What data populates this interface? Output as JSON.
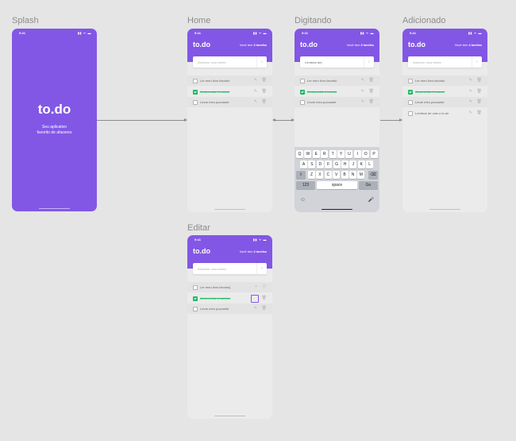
{
  "frames": {
    "splash": "Splash",
    "home": "Home",
    "typing": "Digitando",
    "added": "Adicionado",
    "edit": "Editar"
  },
  "status_time": "9:41",
  "status_icons": "▮▮ ᯤ ▬",
  "app": {
    "logo": "to.do",
    "tagline_1": "Seu aplicativo",
    "tagline_2": "favorito de afazeres",
    "count_prefix": "Você tem",
    "count_3": "3 tarefas",
    "count_4": "4 tarefas",
    "input_placeholder": "Adicione uma tarefa",
    "input_typed": "Lembrar de|",
    "send_icon": "›"
  },
  "tasks": {
    "t1": "Ler meu livro favorito",
    "t1_edit": "Ler meu livro favorito|",
    "t2": "Amamentar o mamei",
    "t2_edit": "Amamentar o carinho",
    "t3": "Levar meu pocoante",
    "t4": "Lembrar de vaio o to.do"
  },
  "icons": {
    "edit": "✎",
    "trash": "🗑"
  },
  "keyboard": {
    "row1": [
      "Q",
      "W",
      "E",
      "R",
      "T",
      "Y",
      "U",
      "I",
      "O",
      "P"
    ],
    "row2": [
      "A",
      "S",
      "D",
      "F",
      "G",
      "H",
      "J",
      "K",
      "L"
    ],
    "row3": [
      "Z",
      "X",
      "C",
      "V",
      "B",
      "N",
      "M"
    ],
    "shift": "⇧",
    "backspace": "⌫",
    "numbers": "123",
    "space": "space",
    "go": "Go",
    "emoji": "☺",
    "mic": "🎤"
  }
}
